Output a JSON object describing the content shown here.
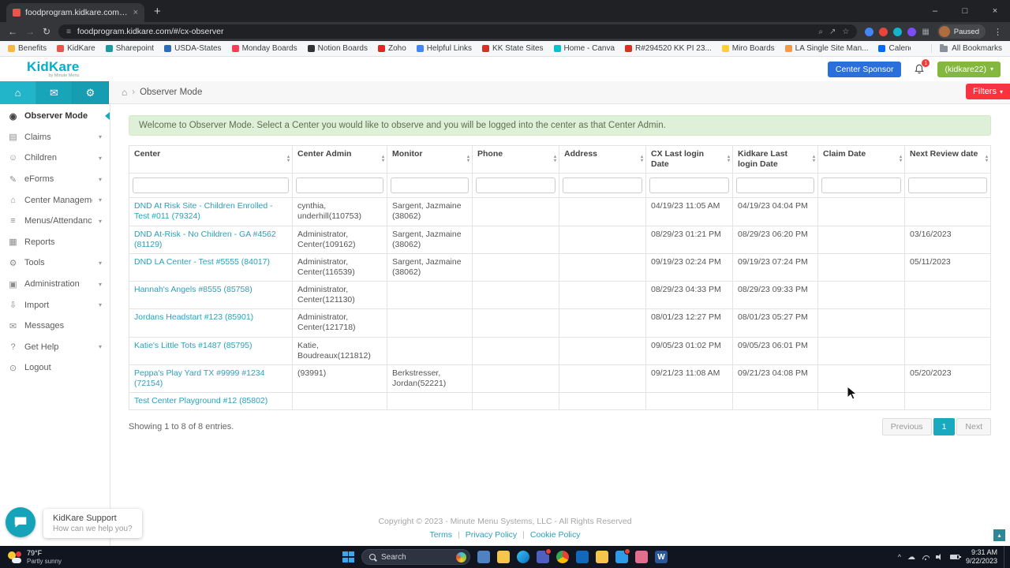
{
  "browser": {
    "tab": {
      "title": "foodprogram.kidkare.com/#/c..."
    },
    "url": "foodprogram.kidkare.com/#/cx-observer",
    "profile_badge": "Paused",
    "all_bookmarks_label": "All Bookmarks",
    "bookmarks": [
      {
        "label": "Benefits",
        "color": "#f5b942"
      },
      {
        "label": "KidKare",
        "color": "#e8554d"
      },
      {
        "label": "Sharepoint",
        "color": "#1a9ba1"
      },
      {
        "label": "USDA-States",
        "color": "#2d6db5"
      },
      {
        "label": "Monday Boards",
        "color": "#ff3d57"
      },
      {
        "label": "Notion Boards",
        "color": "#333333"
      },
      {
        "label": "Zoho",
        "color": "#e42527"
      },
      {
        "label": "Helpful Links",
        "color": "#4285f4"
      },
      {
        "label": "KK State Sites",
        "color": "#d93025"
      },
      {
        "label": "Home - Canva",
        "color": "#00c4cc"
      },
      {
        "label": "R#294520 KK PI 23...",
        "color": "#d93025"
      },
      {
        "label": "Miro Boards",
        "color": "#ffd02f"
      },
      {
        "label": "LA Single Site Man...",
        "color": "#f2994a"
      },
      {
        "label": "Calendly",
        "color": "#006bff"
      }
    ]
  },
  "header": {
    "logo_text": "KidKare",
    "logo_sub": "by Minute Menu",
    "center_sponsor_button": "Center Sponsor",
    "notification_count": "1",
    "account_button": "(kidkare22)"
  },
  "navbar": {
    "breadcrumb": "Observer Mode",
    "filters_button": "Filters"
  },
  "sidebar": {
    "items": [
      {
        "label": "Observer Mode",
        "icon": "eye",
        "active": true,
        "chevron": false
      },
      {
        "label": "Claims",
        "icon": "claims",
        "active": false,
        "chevron": true
      },
      {
        "label": "Children",
        "icon": "children",
        "active": false,
        "chevron": true
      },
      {
        "label": "eForms",
        "icon": "eforms",
        "active": false,
        "chevron": true
      },
      {
        "label": "Center Management",
        "icon": "house",
        "active": false,
        "chevron": true
      },
      {
        "label": "Menus/Attendance",
        "icon": "menus",
        "active": false,
        "chevron": true
      },
      {
        "label": "Reports",
        "icon": "reports",
        "active": false,
        "chevron": false
      },
      {
        "label": "Tools",
        "icon": "gear",
        "active": false,
        "chevron": true
      },
      {
        "label": "Administration",
        "icon": "admin",
        "active": false,
        "chevron": true
      },
      {
        "label": "Import",
        "icon": "import",
        "active": false,
        "chevron": true
      },
      {
        "label": "Messages",
        "icon": "mail",
        "active": false,
        "chevron": false
      },
      {
        "label": "Get Help",
        "icon": "help",
        "active": false,
        "chevron": true
      },
      {
        "label": "Logout",
        "icon": "power",
        "active": false,
        "chevron": false
      }
    ]
  },
  "main": {
    "welcome_message": "Welcome to Observer Mode. Select a Center you would like to observe and you will be logged into the center as that Center Admin.",
    "table": {
      "columns": [
        "Center",
        "Center Admin",
        "Monitor",
        "Phone",
        "Address",
        "CX Last login Date",
        "Kidkare Last login Date",
        "Claim Date",
        "Next Review date"
      ],
      "rows": [
        [
          "DND At Risk Site - Children Enrolled - Test #011 (79324)",
          "cynthia, underhill(110753)",
          "Sargent, Jazmaine (38062)",
          "",
          "",
          "04/19/23 11:05 AM",
          "04/19/23 04:04 PM",
          "",
          ""
        ],
        [
          "DND At-Risk - No Children - GA #4562 (81129)",
          "Administrator, Center(109162)",
          "Sargent, Jazmaine (38062)",
          "",
          "",
          "08/29/23 01:21 PM",
          "08/29/23 06:20 PM",
          "",
          "03/16/2023"
        ],
        [
          "DND LA Center - Test #5555 (84017)",
          "Administrator, Center(116539)",
          "Sargent, Jazmaine (38062)",
          "",
          "",
          "09/19/23 02:24 PM",
          "09/19/23 07:24 PM",
          "",
          "05/11/2023"
        ],
        [
          "Hannah's Angels #8555 (85758)",
          "Administrator, Center(121130)",
          "",
          "",
          "",
          "08/29/23 04:33 PM",
          "08/29/23 09:33 PM",
          "",
          ""
        ],
        [
          "Jordans Headstart #123 (85901)",
          "Administrator, Center(121718)",
          "",
          "",
          "",
          "08/01/23 12:27 PM",
          "08/01/23 05:27 PM",
          "",
          ""
        ],
        [
          "Katie's Little Tots #1487 (85795)",
          "Katie, Boudreaux(121812)",
          "",
          "",
          "",
          "09/05/23 01:02 PM",
          "09/05/23 06:01 PM",
          "",
          ""
        ],
        [
          "Peppa's Play Yard TX #9999 #1234 (72154)",
          "(93991)",
          "Berkstresser, Jordan(52221)",
          "",
          "",
          "09/21/23 11:08 AM",
          "09/21/23 04:08 PM",
          "",
          "05/20/2023"
        ],
        [
          "Test Center Playground #12 (85802)",
          "",
          "",
          "",
          "",
          "",
          "",
          "",
          ""
        ]
      ]
    },
    "showing_text": "Showing 1 to 8 of 8 entries.",
    "pagination": {
      "previous": "Previous",
      "current": "1",
      "next": "Next"
    }
  },
  "footer": {
    "copyright": "Copyright © 2023 - Minute Menu Systems, LLC - All Rights Reserved",
    "links": [
      "Terms",
      "Privacy Policy",
      "Cookie Policy"
    ]
  },
  "chat": {
    "title": "KidKare Support",
    "subtitle": "How can we help you?"
  },
  "taskbar": {
    "weather_temp": "79°F",
    "weather_desc": "Partly sunny",
    "search_placeholder": "Search",
    "time": "9:31 AM",
    "date": "9/22/2023",
    "icons": [
      {
        "name": "task-view-icon",
        "bg": "#4f82c2",
        "badge": false
      },
      {
        "name": "file-explorer-icon",
        "bg": "#f6c64a",
        "badge": false
      },
      {
        "name": "edge-icon",
        "bg": "linear-gradient(135deg,#35c3f3,#0f6cbd)",
        "round": true,
        "badge": false
      },
      {
        "name": "teams-icon",
        "bg": "#4e5fbf",
        "badge": true
      },
      {
        "name": "chrome-icon",
        "bg": "conic-gradient(#ea4335 0 33%,#fbbc05 0 66%,#34a853 0 100%)",
        "round": true,
        "badge": false
      },
      {
        "name": "outlook-icon",
        "bg": "#1268bb",
        "badge": false
      },
      {
        "name": "folder-icon",
        "bg": "#f6c64a",
        "badge": false
      },
      {
        "name": "photos-icon",
        "bg": "#2e9be6",
        "badge": true
      },
      {
        "name": "paint-icon",
        "bg": "#e46d8e",
        "badge": false
      },
      {
        "name": "word-icon",
        "bg": "#2b579a",
        "letter": "W",
        "badge": false
      }
    ]
  }
}
